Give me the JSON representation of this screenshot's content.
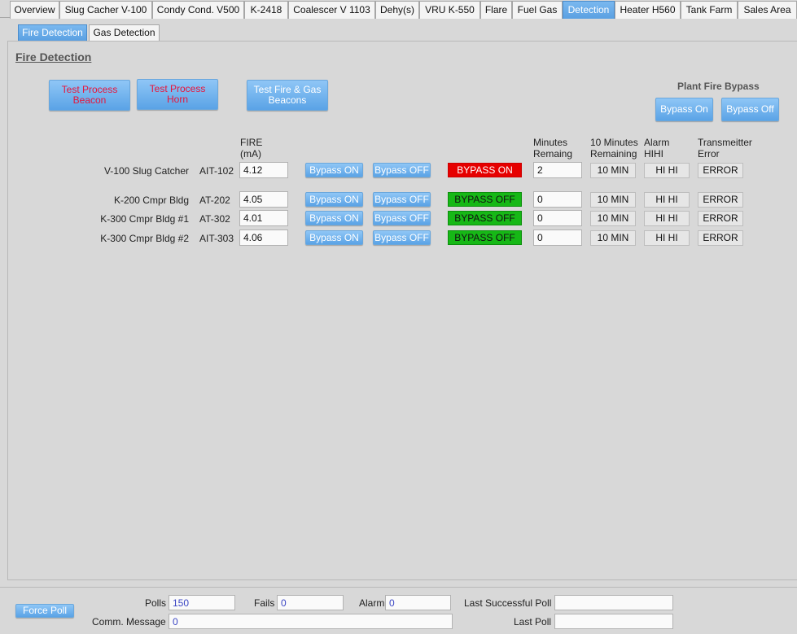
{
  "top_tabs": [
    {
      "label": "Overview",
      "active": false
    },
    {
      "label": "Slug Cacher V-100",
      "active": false
    },
    {
      "label": "Condy Cond. V500",
      "active": false
    },
    {
      "label": "K-2418",
      "active": false
    },
    {
      "label": "Coalescer V 1103",
      "active": false
    },
    {
      "label": "Dehy(s)",
      "active": false
    },
    {
      "label": "VRU K-550",
      "active": false
    },
    {
      "label": "Flare",
      "active": false
    },
    {
      "label": "Fuel Gas",
      "active": false
    },
    {
      "label": "Detection",
      "active": true
    },
    {
      "label": "Heater H560",
      "active": false
    },
    {
      "label": "Tank Farm",
      "active": false
    },
    {
      "label": "Sales Area",
      "active": false
    }
  ],
  "sub_tabs": [
    {
      "label": "Fire Detection",
      "active": true
    },
    {
      "label": "Gas Detection",
      "active": false
    }
  ],
  "section_title": "Fire Detection",
  "actions": {
    "test_beacon": "Test Process Beacon",
    "test_horn": "Test Process Horn",
    "test_fire_gas": "Test Fire & Gas Beacons"
  },
  "plant_bypass": {
    "title": "Plant Fire Bypass",
    "on_label": "Bypass On",
    "off_label": "Bypass Off"
  },
  "columns": {
    "fire": "FIRE",
    "fire_unit": "(mA)",
    "minutes_remaining": "Minutes",
    "minutes_remaining2": "Remaing",
    "ten_minutes": "10 Minutes",
    "ten_minutes2": "Remaining",
    "alarm": "Alarm",
    "alarm2": "HIHI",
    "transmitter": "Transmeitter",
    "transmitter2": "Error"
  },
  "rows": [
    {
      "location": "V-100 Slug Catcher",
      "tag": "AIT-102",
      "fire": "4.12",
      "bypass_on": "Bypass ON",
      "bypass_off": "Bypass OFF",
      "status": "BYPASS ON",
      "status_color": "#e60000",
      "minutes": "2",
      "ten_min": "10 MIN",
      "alarm": "HI HI",
      "error": "ERROR"
    },
    {
      "location": "K-200 Cmpr Bldg",
      "tag": "AT-202",
      "fire": "4.05",
      "bypass_on": "Bypass ON",
      "bypass_off": "Bypass OFF",
      "status": "BYPASS OFF",
      "status_color": "#16b816",
      "minutes": "0",
      "ten_min": "10 MIN",
      "alarm": "HI HI",
      "error": "ERROR"
    },
    {
      "location": "K-300 Cmpr Bldg #1",
      "tag": "AT-302",
      "fire": "4.01",
      "bypass_on": "Bypass ON",
      "bypass_off": "Bypass OFF",
      "status": "BYPASS OFF",
      "status_color": "#16b816",
      "minutes": "0",
      "ten_min": "10 MIN",
      "alarm": "HI HI",
      "error": "ERROR"
    },
    {
      "location": "K-300 Cmpr Bldg #2",
      "tag": "AIT-303",
      "fire": "4.06",
      "bypass_on": "Bypass ON",
      "bypass_off": "Bypass OFF",
      "status": "BYPASS OFF",
      "status_color": "#16b816",
      "minutes": "0",
      "ten_min": "10 MIN",
      "alarm": "HI HI",
      "error": "ERROR"
    }
  ],
  "footer": {
    "force_poll": "Force Poll",
    "polls_label": "Polls",
    "polls_value": "150",
    "fails_label": "Fails",
    "fails_value": "0",
    "alarm_label": "Alarm",
    "alarm_value": "0",
    "last_success_label": "Last Successful Poll",
    "last_success_value": "",
    "comm_label": "Comm. Message",
    "comm_value": "0",
    "last_poll_label": "Last Poll",
    "last_poll_value": ""
  }
}
